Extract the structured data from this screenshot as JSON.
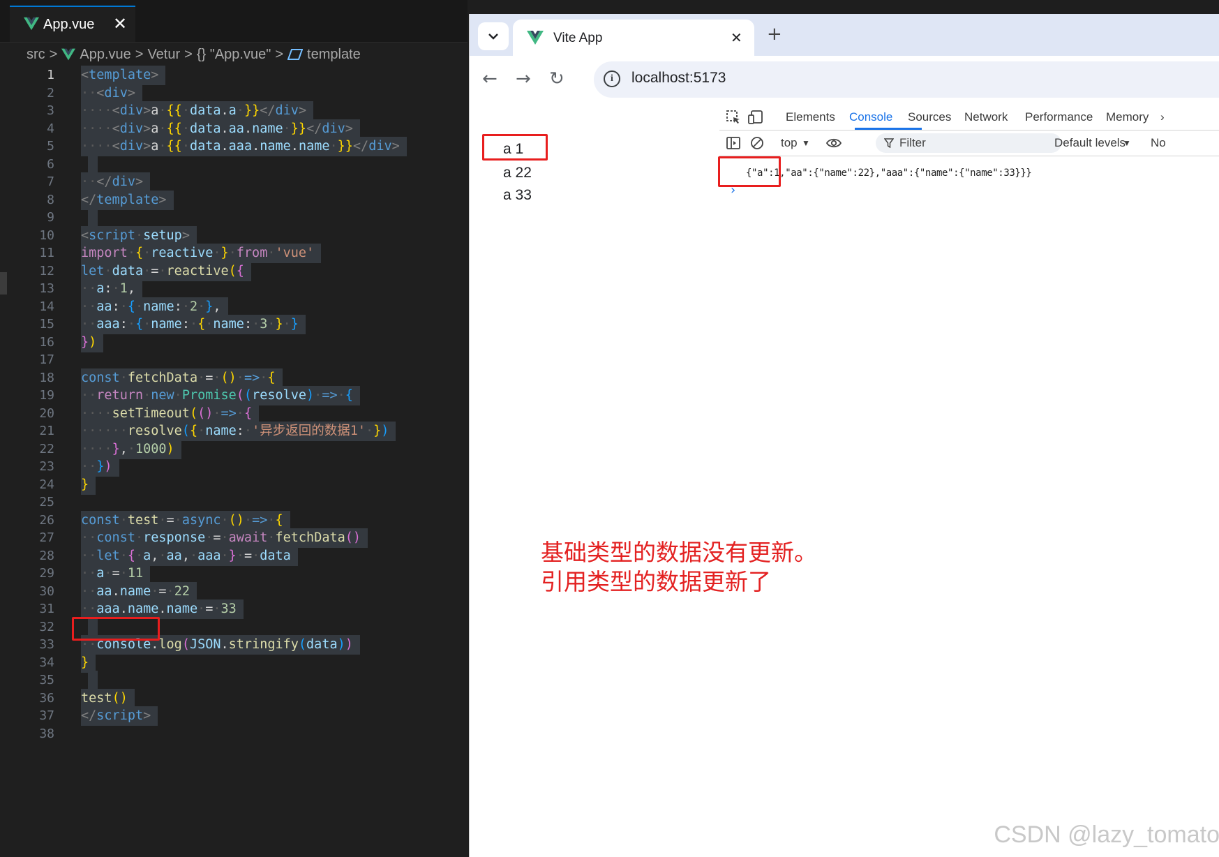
{
  "editor": {
    "tab": {
      "title": "App.vue",
      "close": "✕"
    },
    "breadcrumb": {
      "items": [
        "src",
        "App.vue",
        "Vetur",
        "{} \"App.vue\"",
        "template"
      ],
      "sep": ">"
    },
    "current_line": "1",
    "lines": [
      {
        "n": "1"
      },
      {
        "n": "2"
      },
      {
        "n": "3"
      },
      {
        "n": "4"
      },
      {
        "n": "5"
      },
      {
        "n": "6"
      },
      {
        "n": "7"
      },
      {
        "n": "8"
      },
      {
        "n": "9"
      },
      {
        "n": "10"
      },
      {
        "n": "11"
      },
      {
        "n": "12"
      },
      {
        "n": "13"
      },
      {
        "n": "14"
      },
      {
        "n": "15"
      },
      {
        "n": "16"
      },
      {
        "n": "17"
      },
      {
        "n": "18"
      },
      {
        "n": "19"
      },
      {
        "n": "20"
      },
      {
        "n": "21"
      },
      {
        "n": "22"
      },
      {
        "n": "23"
      },
      {
        "n": "24"
      },
      {
        "n": "25"
      },
      {
        "n": "26"
      },
      {
        "n": "27"
      },
      {
        "n": "28"
      },
      {
        "n": "29"
      },
      {
        "n": "30"
      },
      {
        "n": "31"
      },
      {
        "n": "32"
      },
      {
        "n": "33"
      },
      {
        "n": "34"
      },
      {
        "n": "35"
      },
      {
        "n": "36"
      },
      {
        "n": "37"
      },
      {
        "n": "38"
      }
    ]
  },
  "browser": {
    "tab_title": "Vite App",
    "tab_close": "✕",
    "new_tab": "+",
    "url": "localhost:5173",
    "page_lines": [
      "a 1",
      "a 22",
      "a 33"
    ],
    "devtools": {
      "tabs": [
        "Elements",
        "Console",
        "Sources",
        "Network",
        "Performance",
        "Memory"
      ],
      "active_tab": "Console",
      "context": "top",
      "filter_placeholder": "Filter",
      "levels": "Default levels",
      "no_issues": "No",
      "log": "{\"a\":1,\"aa\":{\"name\":22},\"aaa\":{\"name\":{\"name\":33}}}"
    }
  },
  "annotation": {
    "line1": "基础类型的数据没有更新。",
    "line2": "引用类型的数据更新了"
  },
  "watermark": "CSDN @lazy_tomato",
  "colors": {
    "accent": "#1a73e8",
    "annotation_red": "#e32121",
    "vue_green": "#41b883"
  }
}
